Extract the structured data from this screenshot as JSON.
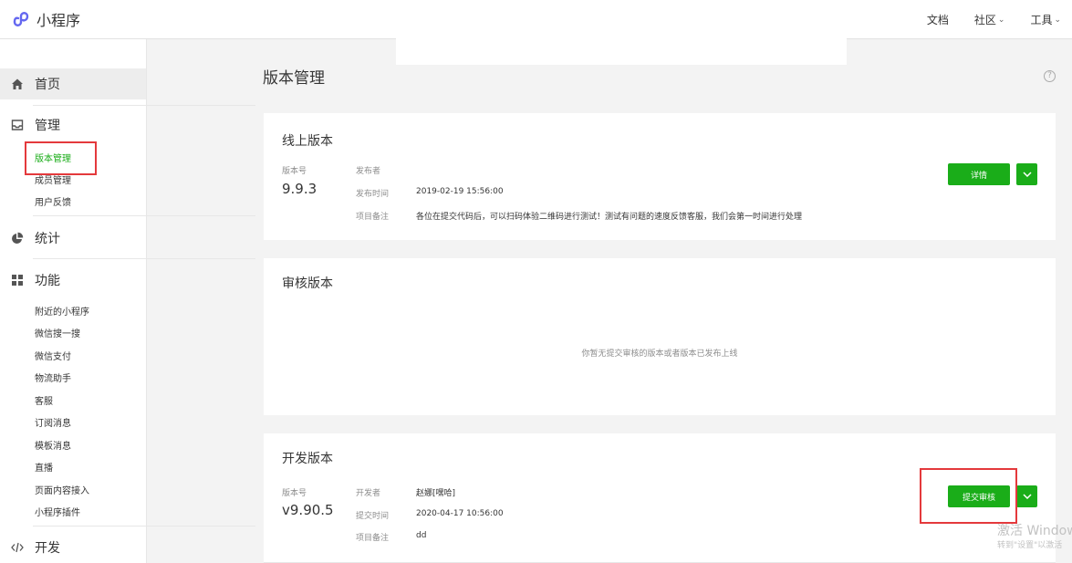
{
  "app": {
    "logo_text": "小程序"
  },
  "top_nav": {
    "docs": "文档",
    "community": "社区",
    "tools": "工具"
  },
  "sidebar": {
    "home": "首页",
    "manage": {
      "label": "管理",
      "items": [
        "版本管理",
        "成员管理",
        "用户反馈"
      ]
    },
    "stats": "统计",
    "features": {
      "label": "功能",
      "items": [
        "附近的小程序",
        "微信搜一搜",
        "微信支付",
        "物流助手",
        "客服",
        "订阅消息",
        "模板消息",
        "直播",
        "页面内容接入",
        "小程序插件"
      ]
    },
    "dev": "开发"
  },
  "page": {
    "title": "版本管理",
    "help": "?"
  },
  "online": {
    "title": "线上版本",
    "version_label": "版本号",
    "version": "9.9.3",
    "publisher_label": "发布者",
    "publisher": "",
    "time_label": "发布时间",
    "time": "2019-02-19 15:56:00",
    "note_label": "项目备注",
    "note": "各位在提交代码后，可以扫码体验二维码进行测试！测试有问题的速度反馈客服，我们会第一时间进行处理",
    "detail_button": "详情"
  },
  "review": {
    "title": "审核版本",
    "empty": "你暂无提交审核的版本或者版本已发布上线"
  },
  "dev_version": {
    "title": "开发版本",
    "version_label": "版本号",
    "version": "v9.90.5",
    "developer_label": "开发者",
    "developer": "赵娜[嘿哈]",
    "time_label": "提交时间",
    "time": "2020-04-17 10:56:00",
    "note_label": "项目备注",
    "note": "dd",
    "submit_button": "提交审核"
  },
  "watermark": {
    "line1": "激活 Windows",
    "line2": "转到\"设置\"以激活"
  },
  "colors": {
    "accent": "#1aad19",
    "highlight": "#e4393c"
  }
}
